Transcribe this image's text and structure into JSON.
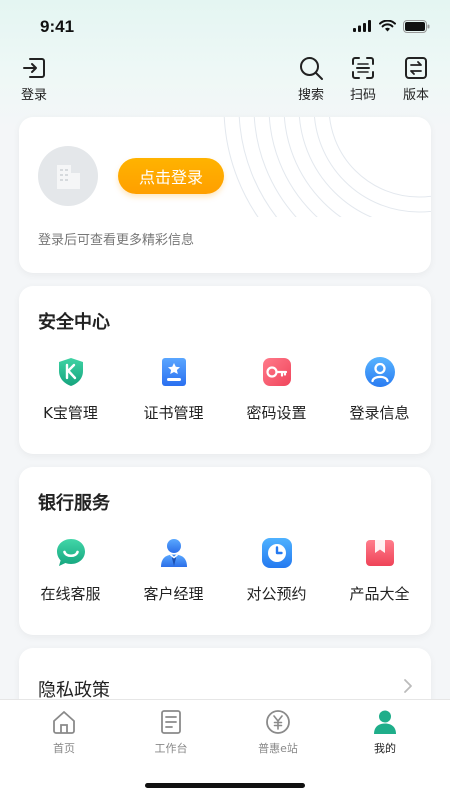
{
  "status_bar": {
    "time": "9:41"
  },
  "top_nav": {
    "login": "登录",
    "search": "搜索",
    "scan": "扫码",
    "version": "版本"
  },
  "login_card": {
    "button": "点击登录",
    "hint": "登录后可查看更多精彩信息"
  },
  "security": {
    "title": "安全中心",
    "items": [
      {
        "label": "K宝管理",
        "icon": "kbao-shield-icon"
      },
      {
        "label": "证书管理",
        "icon": "certificate-icon"
      },
      {
        "label": "密码设置",
        "icon": "key-icon"
      },
      {
        "label": "登录信息",
        "icon": "user-info-icon"
      }
    ]
  },
  "bank": {
    "title": "银行服务",
    "items": [
      {
        "label": "在线客服",
        "icon": "chat-smile-icon"
      },
      {
        "label": "客户经理",
        "icon": "manager-icon"
      },
      {
        "label": "对公预约",
        "icon": "clock-icon"
      },
      {
        "label": "产品大全",
        "icon": "bookmark-icon"
      }
    ]
  },
  "privacy": {
    "title": "隐私政策"
  },
  "tabs": [
    {
      "label": "首页",
      "icon": "home-icon"
    },
    {
      "label": "工作台",
      "icon": "workbench-icon"
    },
    {
      "label": "普惠e站",
      "icon": "yuan-icon"
    },
    {
      "label": "我的",
      "icon": "profile-icon",
      "active": true
    }
  ],
  "colors": {
    "accent_green": "#1fae8a",
    "login_orange": "#ffa500"
  }
}
